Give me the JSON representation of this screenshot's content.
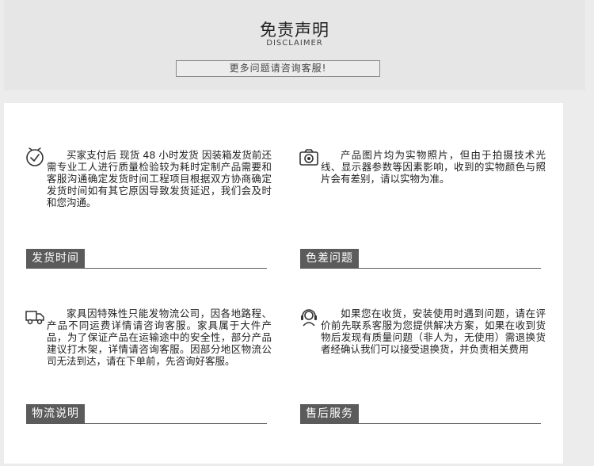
{
  "header": {
    "title": "免责声明",
    "subtitle": "DISCLAIMER",
    "more_button": "更多问题请咨询客服!"
  },
  "cards": [
    {
      "icon": "clock-icon",
      "text": "买家支付后 现货 48 小时发货 因装箱发货前还需专业工人进行质量检验较为耗时定制产品需要和客服沟通确定发货时间工程项目根据双方协商确定发货时间如有其它原因导致发货延迟，我们会及时和您沟通。",
      "tag": "发货时间"
    },
    {
      "icon": "camera-icon",
      "text": "产品图片均为实物照片，但由于拍摄技术光线、显示器参数等因素影响，收到的实物颜色与照片会有差别，请以实物为准。",
      "tag": "色差问题"
    },
    {
      "icon": "truck-icon",
      "text": "家具因特殊性只能发物流公司，因各地路程、产品不同运费详情请咨询客服。家具属于大件产品，为了保证产品在运输途中的安全性，部分产品建议打木架，详情请咨询客服。因部分地区物流公司无法到达，请在下单前，先咨询好客服。",
      "tag": "物流说明"
    },
    {
      "icon": "customer-service-icon",
      "text": "如果您在收货，安装使用时遇到问题，请在评价前先联系客服为您提供解决方案，如果在收到货物后发现有质量问题（非人为，无使用）需退换货者经确认我们可以接受退换货，并负责相关费用",
      "tag": "售后服务"
    }
  ],
  "colors": {
    "tag_background": "#5b5b5b",
    "header_band": "#e6e6e6",
    "panel": "#ffffff"
  }
}
